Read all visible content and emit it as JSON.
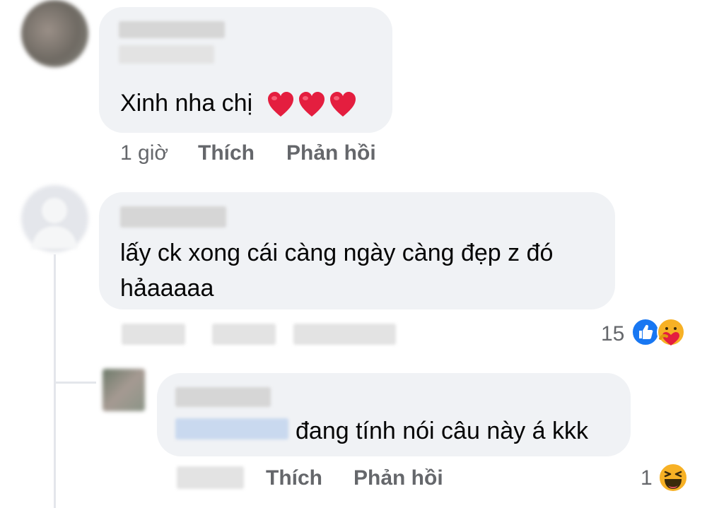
{
  "comments": [
    {
      "text": "Xinh nha chị",
      "emoji_count": 3,
      "emoji": "heart-icon",
      "actions": {
        "time": "1 giờ",
        "like": "Thích",
        "reply": "Phản hồi"
      }
    },
    {
      "text": "lấy ck xong cái càng ngày càng đẹp z đó hảaaaaa",
      "line1": "lấy ck xong cái càng ngày càng đẹp z đó",
      "line2": "hảaaaaa",
      "reactions": {
        "count": "15",
        "types": [
          "like-icon",
          "care-icon"
        ]
      }
    },
    {
      "text": "đang tính nói câu này á kkk",
      "actions": {
        "like": "Thích",
        "reply": "Phản hồi"
      },
      "reactions": {
        "count": "1",
        "types": [
          "haha-icon"
        ]
      }
    }
  ],
  "colors": {
    "bubble": "#f0f2f5",
    "meta": "#65676b",
    "text": "#050505",
    "like_blue": "#1877f2",
    "heart_red": "#e41e3f"
  }
}
